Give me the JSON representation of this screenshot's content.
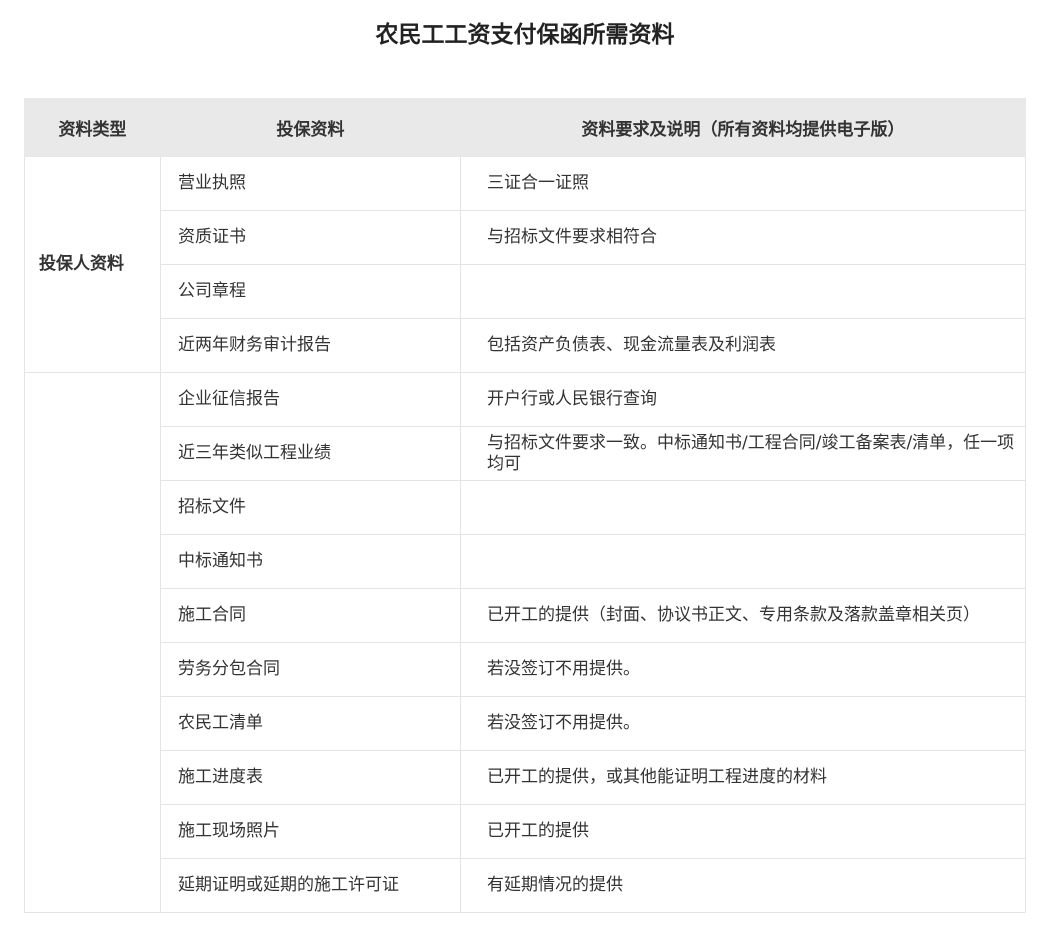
{
  "title": "农民工工资支付保函所需资料",
  "table": {
    "headers": {
      "type": "资料类型",
      "material": "投保资料",
      "requirement": "资料要求及说明（所有资料均提供电子版）"
    },
    "groups": [
      {
        "category": "投保人资料",
        "rows": [
          {
            "material": "营业执照",
            "requirement": "三证合一证照"
          },
          {
            "material": "资质证书",
            "requirement": "与招标文件要求相符合"
          },
          {
            "material": "公司章程",
            "requirement": ""
          },
          {
            "material": "近两年财务审计报告",
            "requirement": "包括资产负债表、现金流量表及利润表"
          }
        ]
      },
      {
        "category": "",
        "rows": [
          {
            "material": "企业征信报告",
            "requirement": "开户行或人民银行查询"
          },
          {
            "material": "近三年类似工程业绩",
            "requirement": "与招标文件要求一致。中标通知书/工程合同/竣工备案表/清单，任一项均可"
          },
          {
            "material": "招标文件",
            "requirement": ""
          },
          {
            "material": "中标通知书",
            "requirement": ""
          },
          {
            "material": "施工合同",
            "requirement": "已开工的提供（封面、协议书正文、专用条款及落款盖章相关页）"
          },
          {
            "material": "劳务分包合同",
            "requirement": "若没签订不用提供。"
          },
          {
            "material": "农民工清单",
            "requirement": "若没签订不用提供。"
          },
          {
            "material": "施工进度表",
            "requirement": "已开工的提供，或其他能证明工程进度的材料"
          },
          {
            "material": "施工现场照片",
            "requirement": "已开工的提供"
          },
          {
            "material": "延期证明或延期的施工许可证",
            "requirement": "有延期情况的提供"
          }
        ]
      }
    ]
  }
}
